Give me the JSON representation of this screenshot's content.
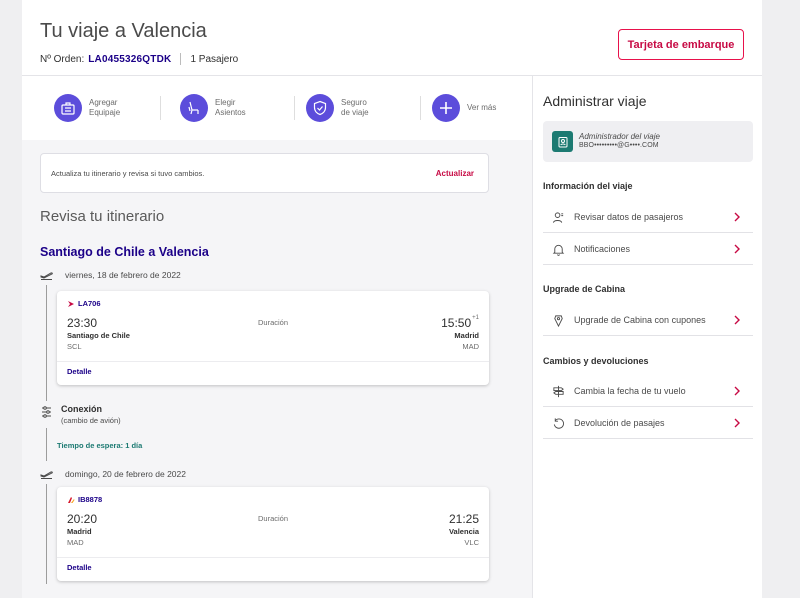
{
  "header": {
    "title": "Tu viaje a Valencia",
    "order_label": "Nº Orden:",
    "order_code": "LA0455326QTDK",
    "passengers": "1 Pasajero",
    "boarding_button": "Tarjeta de embarque"
  },
  "services": [
    {
      "label_1": "Agregar",
      "label_2": "Equipaje",
      "icon": "luggage-icon"
    },
    {
      "label_1": "Elegir",
      "label_2": "Asientos",
      "icon": "seat-icon"
    },
    {
      "label_1": "Seguro",
      "label_2": "de viaje",
      "icon": "shield-icon"
    },
    {
      "label_1": "Ver más",
      "label_2": "",
      "icon": "plus-icon"
    }
  ],
  "banner": {
    "text": "Actualiza tu itinerario y revisa si tuvo cambios.",
    "link": "Actualizar"
  },
  "itinerary": {
    "title": "Revisa tu itinerario",
    "route": "Santiago de Chile a Valencia",
    "segments": [
      {
        "date": "viernes, 18 de febrero de 2022",
        "flight_code": "LA706",
        "dep_time": "23:30",
        "dep_city": "Santiago de Chile",
        "dep_code": "SCL",
        "duration_label": "Duración",
        "arr_time": "15:50",
        "arr_day_offset": "+1",
        "arr_city": "Madrid",
        "arr_code": "MAD",
        "detail": "Detalle"
      },
      {
        "date": "domingo, 20 de febrero de 2022",
        "flight_code": "IB8878",
        "dep_time": "20:20",
        "dep_city": "Madrid",
        "dep_code": "MAD",
        "duration_label": "Duración",
        "arr_time": "21:25",
        "arr_city": "Valencia",
        "arr_code": "VLC",
        "detail": "Detalle"
      }
    ],
    "connection": {
      "title": "Conexión",
      "subtitle": "(cambio de avión)",
      "wait": "Tiempo de espera: 1 día"
    }
  },
  "sidebar": {
    "title": "Administrar viaje",
    "admin_role": "Administrador del viaje",
    "admin_email": "BBO•••••••••@G••••.COM",
    "sections": [
      {
        "title": "Información del viaje",
        "items": [
          {
            "label": "Revisar datos de pasajeros",
            "icon": "person-icon"
          },
          {
            "label": "Notificaciones",
            "icon": "bell-icon"
          }
        ]
      },
      {
        "title": "Upgrade de Cabina",
        "items": [
          {
            "label": "Upgrade de Cabina con cupones",
            "icon": "tag-icon"
          }
        ]
      },
      {
        "title": "Cambios y devoluciones",
        "items": [
          {
            "label": "Cambia la fecha de tu vuelo",
            "icon": "signpost-icon"
          },
          {
            "label": "Devolución de pasajes",
            "icon": "refund-icon"
          }
        ]
      }
    ]
  },
  "colors": {
    "brand_indigo": "#1b0088",
    "accent_red": "#e8114b",
    "service_purple": "#5c4ddb",
    "teal": "#1c7a72"
  }
}
